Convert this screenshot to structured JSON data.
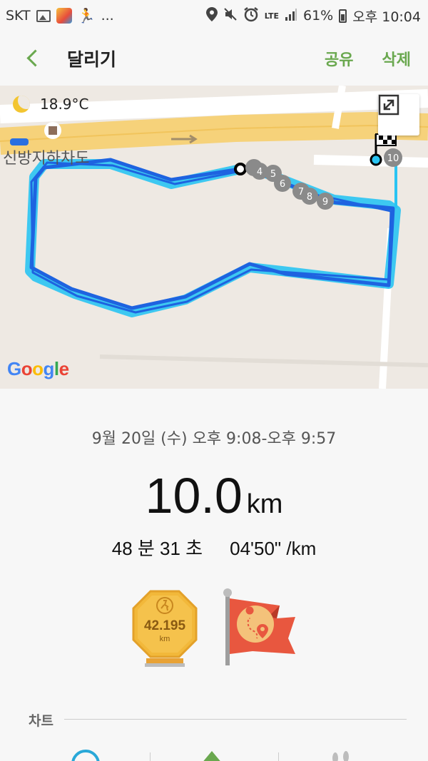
{
  "status_bar": {
    "carrier": "SKT",
    "more": "...",
    "network": "LTE",
    "battery": "61%",
    "time": "오후 10:04"
  },
  "header": {
    "title": "달리기",
    "share_label": "공유",
    "delete_label": "삭제"
  },
  "map": {
    "temperature": "18.9°C",
    "place_label": "신방지하차도",
    "attribution": "Google",
    "route_color": "#1e63e0",
    "route_glow_color": "#29c4f2",
    "km_markers": [
      "4",
      "5",
      "6",
      "7",
      "8",
      "9",
      "10"
    ]
  },
  "summary": {
    "datetime": "9월 20일 (수) 오후 9:08-오후 9:57",
    "distance_value": "10.0",
    "distance_unit": "km",
    "duration": "48 분 31 초",
    "pace": "04'50\" /km"
  },
  "badges": {
    "medal_value": "42.195",
    "medal_unit": "km"
  },
  "chart_section": {
    "label": "차트"
  },
  "colors": {
    "accent": "#6aa84f",
    "medal_gold": "#f2b83a",
    "flag_red": "#e8573f"
  }
}
